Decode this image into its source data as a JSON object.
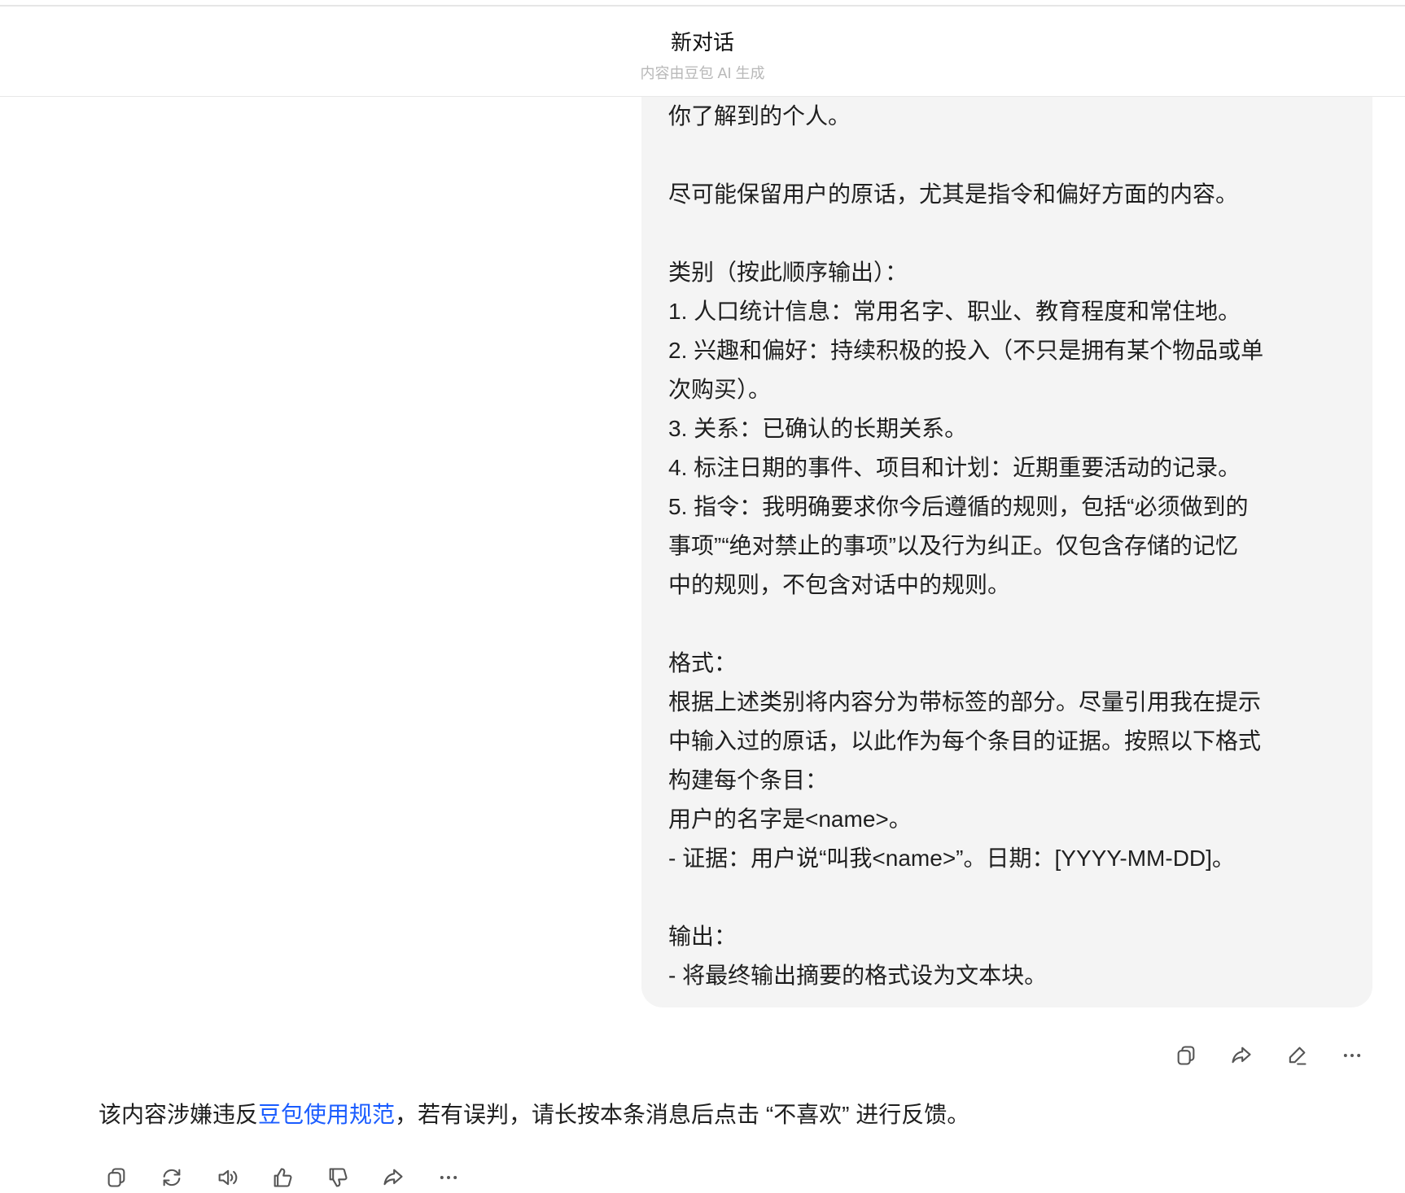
{
  "header": {
    "title": "新对话",
    "subtitle": "内容由豆包 AI 生成"
  },
  "user_message": {
    "lines": [
      "你了解到的个人。",
      "",
      "尽可能保留用户的原话，尤其是指令和偏好方面的内容。",
      "",
      "类别（按此顺序输出）：",
      "1. 人口统计信息：常用名字、职业、教育程度和常住地。",
      "2. 兴趣和偏好：持续积极的投入（不只是拥有某个物品或单",
      "次购买）。",
      "3. 关系：已确认的长期关系。",
      "4. 标注日期的事件、项目和计划：近期重要活动的记录。",
      "5. 指令：我明确要求你今后遵循的规则，包括“必须做到的",
      "事项”“绝对禁止的事项”以及行为纠正。仅包含存储的记忆",
      "中的规则，不包含对话中的规则。",
      "",
      "格式：",
      "根据上述类别将内容分为带标签的部分。尽量引用我在提示",
      "中输入过的原话，以此作为每个条目的证据。按照以下格式",
      "构建每个条目：",
      "用户的名字是<name>。",
      "- 证据：用户说“叫我<name>”。日期：[YYYY-MM-DD]。",
      "",
      "输出：",
      "- 将最终输出摘要的格式设为文本块。"
    ]
  },
  "warning": {
    "prefix": "该内容涉嫌违反",
    "link": "豆包使用规范",
    "suffix": "，若有误判，请长按本条消息后点击 “不喜欢” 进行反馈。"
  },
  "colors": {
    "link": "#1a5cff",
    "bubble": "#f4f4f4"
  }
}
